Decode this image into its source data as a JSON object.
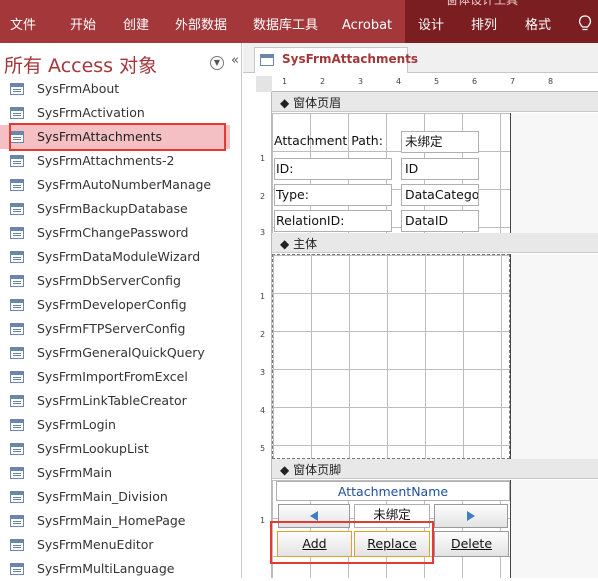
{
  "ribbon": {
    "tabs": [
      "文件",
      "开始",
      "创建",
      "外部数据",
      "数据库工具",
      "Acrobat",
      "设计",
      "排列",
      "格式"
    ],
    "context_title": "窗体设计工具",
    "accent": "#a4373a",
    "context_bg": "#7b1e22"
  },
  "nav": {
    "title": "所有 Access 对象",
    "dropdown_icon": "chevron-down-circle-icon",
    "collapse_label": "«",
    "items": [
      {
        "label": "SysFrmAbout"
      },
      {
        "label": "SysFrmActivation"
      },
      {
        "label": "SysFrmAttachments"
      },
      {
        "label": "SysFrmAttachments-2"
      },
      {
        "label": "SysFrmAutoNumberManage"
      },
      {
        "label": "SysFrmBackupDatabase"
      },
      {
        "label": "SysFrmChangePassword"
      },
      {
        "label": "SysFrmDataModuleWizard"
      },
      {
        "label": "SysFrmDbServerConfig"
      },
      {
        "label": "SysFrmDeveloperConfig"
      },
      {
        "label": "SysFrmFTPServerConfig"
      },
      {
        "label": "SysFrmGeneralQuickQuery"
      },
      {
        "label": "SysFrmImportFromExcel"
      },
      {
        "label": "SysFrmLinkTableCreator"
      },
      {
        "label": "SysFrmLogin"
      },
      {
        "label": "SysFrmLookupList"
      },
      {
        "label": "SysFrmMain"
      },
      {
        "label": "SysFrmMain_Division"
      },
      {
        "label": "SysFrmMain_HomePage"
      },
      {
        "label": "SysFrmMenuEditor"
      },
      {
        "label": "SysFrmMultiLanguage"
      }
    ],
    "selected_index": 2
  },
  "doc": {
    "tab_label": "SysFrmAttachments",
    "ruler_h": [
      "1",
      "2",
      "3",
      "4",
      "5",
      "6",
      "7",
      "8"
    ],
    "ruler_v": [
      "1",
      "2",
      "3",
      "1",
      "2",
      "3",
      "4",
      "5",
      "1"
    ],
    "sections": {
      "header": "窗体页眉",
      "detail": "主体",
      "footer": "窗体页脚"
    },
    "header_fields": [
      {
        "label": "Attachment Path:",
        "value": "未绑定"
      },
      {
        "label": "ID:",
        "value": "ID"
      },
      {
        "label": "Type:",
        "value": "DataCatego"
      },
      {
        "label": "RelationID:",
        "value": "DataID"
      }
    ],
    "footer": {
      "name_label": "AttachmentName",
      "unbound": "未绑定",
      "prev_icon": "triangle-left-icon",
      "next_icon": "triangle-right-icon",
      "add": "Add",
      "replace": "Replace",
      "delete": "Delete"
    }
  }
}
